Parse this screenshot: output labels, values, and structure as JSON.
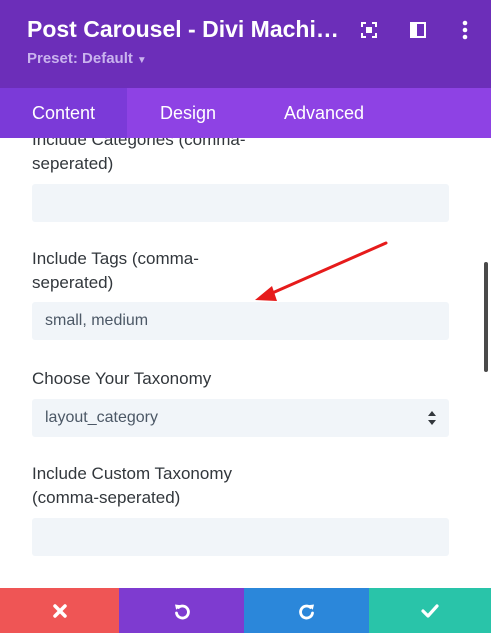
{
  "header": {
    "title": "Post Carousel - Divi Machin...",
    "preset": "Preset: Default",
    "icons": [
      "focus-icon",
      "split-view-icon",
      "more-options-icon"
    ]
  },
  "tabs": [
    {
      "label": "Content",
      "active": true
    },
    {
      "label": "Design",
      "active": false
    },
    {
      "label": "Advanced",
      "active": false
    }
  ],
  "fields": {
    "include_categories": {
      "label_line1": "Include Categories (comma-",
      "label_line2": "seperated)",
      "value": ""
    },
    "include_tags": {
      "label_line1": "Include Tags (comma-",
      "label_line2": "seperated)",
      "value": "small, medium"
    },
    "taxonomy": {
      "label": "Choose Your Taxonomy",
      "value": "layout_category"
    },
    "custom_taxonomy": {
      "label_line1": "Include Custom Taxonomy",
      "label_line2": "(comma-seperated)",
      "value": ""
    }
  },
  "footer": {
    "buttons": [
      {
        "icon": "close-icon",
        "color": "#ef5555"
      },
      {
        "icon": "undo-icon",
        "color": "#7e3bd0"
      },
      {
        "icon": "redo-icon",
        "color": "#2b87da"
      },
      {
        "icon": "check-icon",
        "color": "#29c4a9"
      }
    ]
  },
  "colors": {
    "header_bg": "#6c2eb9",
    "tabs_bg": "#8e42e4",
    "annotation_arrow": "#e61b1b"
  }
}
